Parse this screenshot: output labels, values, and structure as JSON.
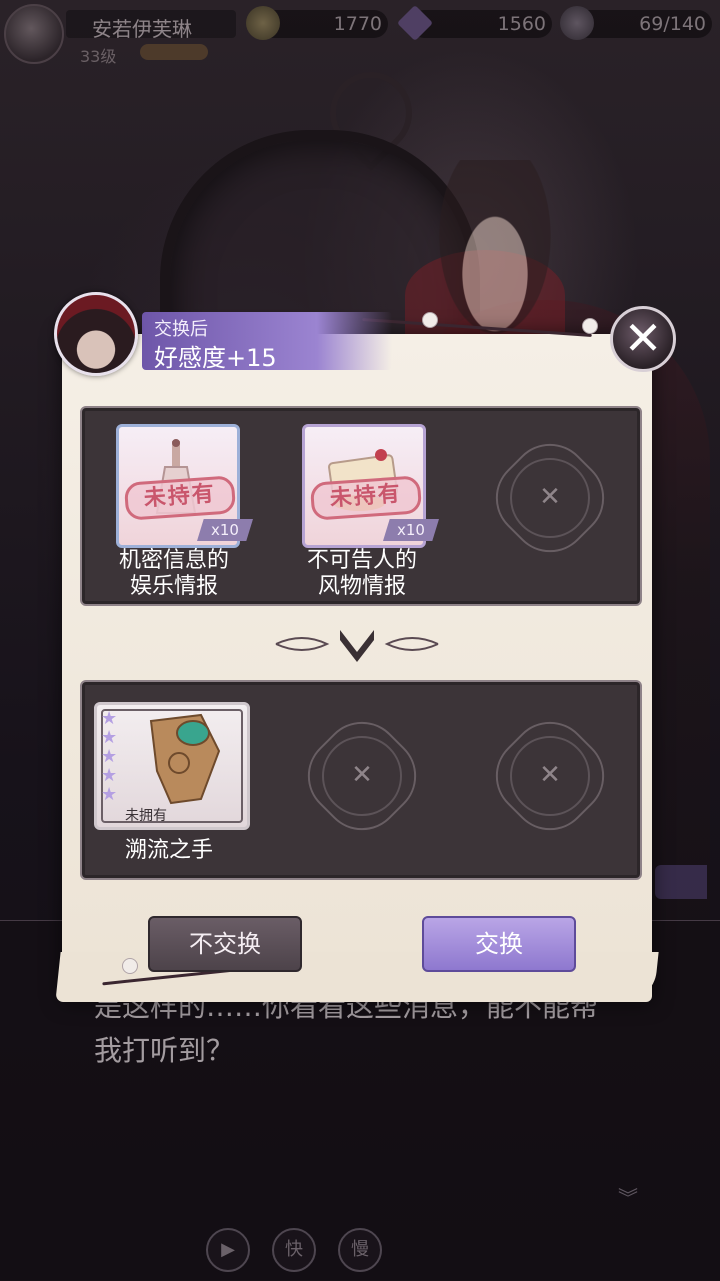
{
  "player": {
    "name": "安若伊芙琳",
    "level": "33级"
  },
  "resources": {
    "gold": "1770",
    "diamond": "1560",
    "stamina": "69/140"
  },
  "dialog": {
    "text": "是这样的……你看看这些消息，能不能帮我打听到？",
    "controls": [
      "▶",
      "快",
      "慢"
    ]
  },
  "exchange": {
    "header_sub": "交换后",
    "header_main": "好感度+15",
    "close_icon": "✕",
    "inputs": [
      {
        "name": "机密信息的\n娱乐情报",
        "status": "未持有",
        "qty": "x10"
      },
      {
        "name": "不可告人的\n风物情报",
        "status": "未持有",
        "qty": "x10"
      }
    ],
    "output": {
      "name": "溯流之手",
      "status": "未拥有",
      "stars": 5
    },
    "decline_label": "不交换",
    "accept_label": "交换"
  },
  "colors": {
    "accent_purple": "#9b84d1",
    "panel_dark": "#3c3438",
    "paper": "#f5efe6"
  }
}
